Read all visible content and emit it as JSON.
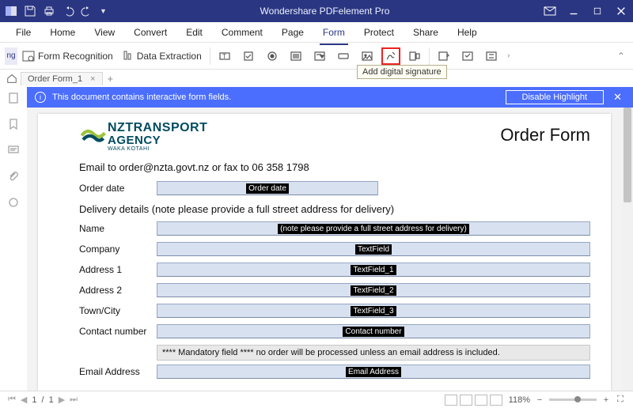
{
  "app": {
    "title": "Wondershare PDFelement Pro"
  },
  "menu": {
    "items": [
      "File",
      "Home",
      "View",
      "Convert",
      "Edit",
      "Comment",
      "Page",
      "Form",
      "Protect",
      "Share",
      "Help"
    ],
    "active": "Form"
  },
  "ribbon": {
    "scroll": "ng",
    "form_recognition": "Form Recognition",
    "data_extraction": "Data Extraction",
    "tooltip": "Add digital signature"
  },
  "tab": {
    "name": "Order Form_1"
  },
  "banner": {
    "message": "This document contains interactive form fields.",
    "button": "Disable Highlight"
  },
  "doc": {
    "logo": {
      "l1": "NZTRANSPORT",
      "l2": "AGENCY",
      "l3": "WAKA KOTAHI"
    },
    "title": "Order Form",
    "email_line": "Email to order@nzta.govt.nz or fax to 06 358 1798",
    "order_date_label": "Order date",
    "order_date_tag": "Order date",
    "delivery_heading": "Delivery details (note please provide a full street address for delivery)",
    "rows": {
      "name": {
        "label": "Name",
        "tag": "(note please provide a full street address for delivery)"
      },
      "company": {
        "label": "Company",
        "tag": "TextField"
      },
      "address1": {
        "label": "Address 1",
        "tag": "TextField_1"
      },
      "address2": {
        "label": "Address 2",
        "tag": "TextField_2"
      },
      "town": {
        "label": "Town/City",
        "tag": "TextField_3"
      },
      "contact": {
        "label": "Contact number",
        "tag": "Contact number"
      },
      "email": {
        "label": "Email Address",
        "tag": "Email Address"
      }
    },
    "mandatory": "**** Mandatory field **** no order will be processed unless an email address is included."
  },
  "status": {
    "page_cur": "1",
    "page_sep": "/",
    "page_total": "1",
    "zoom": "118%"
  }
}
